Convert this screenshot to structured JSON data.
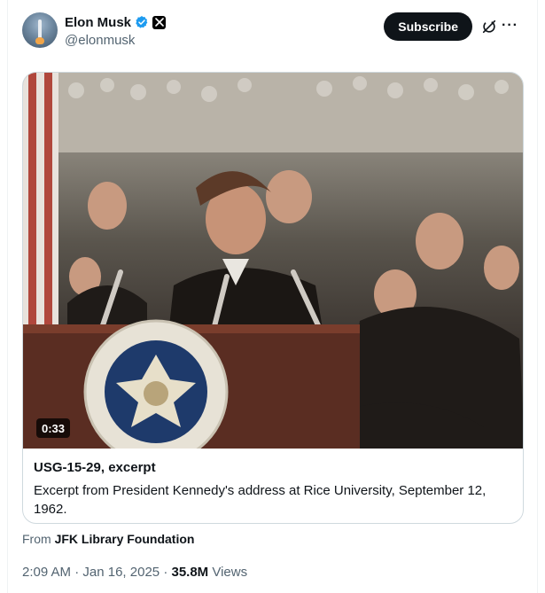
{
  "post": {
    "author": {
      "display_name": "Elon Musk",
      "handle": "@elonmusk",
      "verified_icon": "verified-badge-icon",
      "affiliation_icon": "x-logo-icon"
    },
    "subscribe_label": "Subscribe",
    "grok_icon": "grok-icon",
    "more_icon": "more-options-icon"
  },
  "media_card": {
    "duration": "0:33",
    "title": "USG-15-29, excerpt",
    "description": "Excerpt from President Kennedy's address at Rice University, September 12, 1962."
  },
  "source": {
    "prefix": "From",
    "name": "JFK Library Foundation"
  },
  "meta": {
    "time": "2:09 AM",
    "separator": "·",
    "date": "Jan 16, 2025",
    "views_count": "35.8M",
    "views_label": "Views"
  },
  "colors": {
    "text_primary": "#0f1419",
    "text_secondary": "#536471",
    "verified_blue": "#1d9bf0",
    "border": "#cfd9de"
  }
}
